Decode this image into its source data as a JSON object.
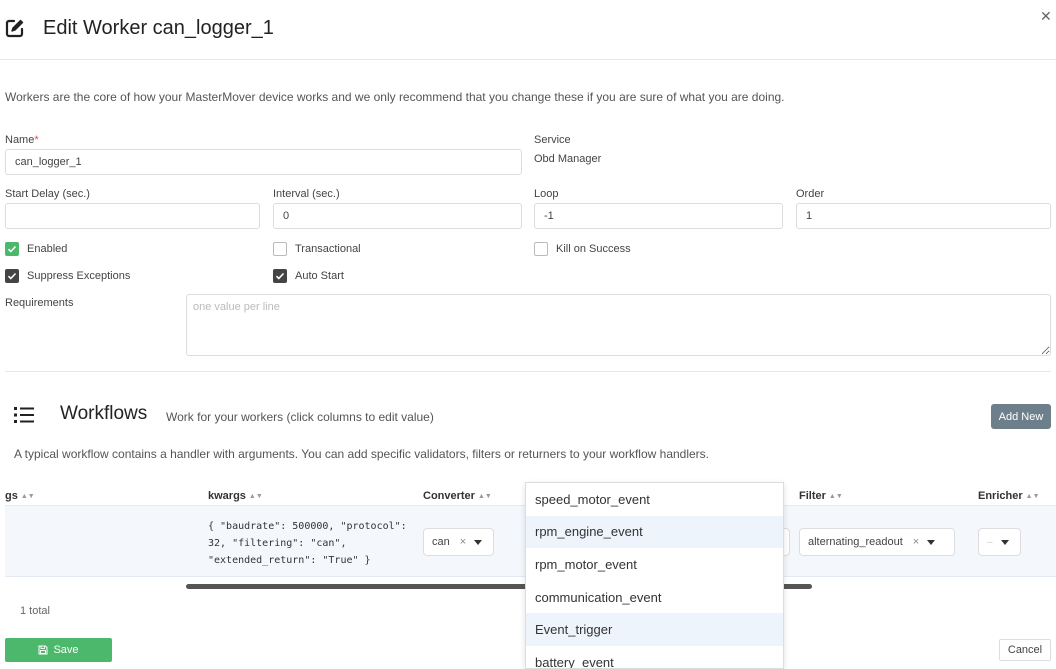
{
  "header": {
    "title": "Edit Worker can_logger_1",
    "close_glyph": "✕"
  },
  "intro": "Workers are the core of how your MasterMover device works and we only recommend that you change these if you are sure of what you are doing.",
  "form": {
    "name_label": "Name",
    "name_required": "*",
    "name_value": "can_logger_1",
    "service_label": "Service",
    "service_value": "Obd Manager",
    "start_delay_label": "Start Delay (sec.)",
    "start_delay_value": "",
    "interval_label": "Interval (sec.)",
    "interval_value": "0",
    "loop_label": "Loop",
    "loop_value": "-1",
    "order_label": "Order",
    "order_value": "1",
    "checkboxes": {
      "enabled": {
        "label": "Enabled",
        "checked": true
      },
      "transactional": {
        "label": "Transactional",
        "checked": false
      },
      "kill_on_success": {
        "label": "Kill on Success",
        "checked": false
      },
      "suppress_exceptions": {
        "label": "Suppress Exceptions",
        "checked": true
      },
      "auto_start": {
        "label": "Auto Start",
        "checked": true
      }
    },
    "requirements_label": "Requirements",
    "requirements_placeholder": "one value per line"
  },
  "workflows": {
    "title": "Workflows",
    "subtitle": "Work for your workers (click columns to edit value)",
    "add_new_label": "Add New",
    "description": "A typical workflow contains a handler with arguments. You can add specific validators, filters or returners to your workflow handlers.",
    "columns": {
      "args": "gs",
      "kwargs": "kwargs",
      "converter": "Converter",
      "filter": "Filter",
      "enricher": "Enricher"
    },
    "row": {
      "kwargs": "{ \"baudrate\": 500000, \"protocol\": 32, \"filtering\": \"can\", \"extended_return\": \"True\" }",
      "converter": "can",
      "filter": "alternating_readout",
      "clear_glyph": "×"
    },
    "total": "1 total",
    "dropdown_options": [
      "speed_motor_event",
      "rpm_engine_event",
      "rpm_motor_event",
      "communication_event",
      "Event_trigger",
      "battery_event"
    ]
  },
  "footer": {
    "save_label": "Save",
    "cancel_label": "Cancel"
  },
  "colors": {
    "accent_green": "#4cb86b",
    "add_button": "#6e7f8c"
  }
}
